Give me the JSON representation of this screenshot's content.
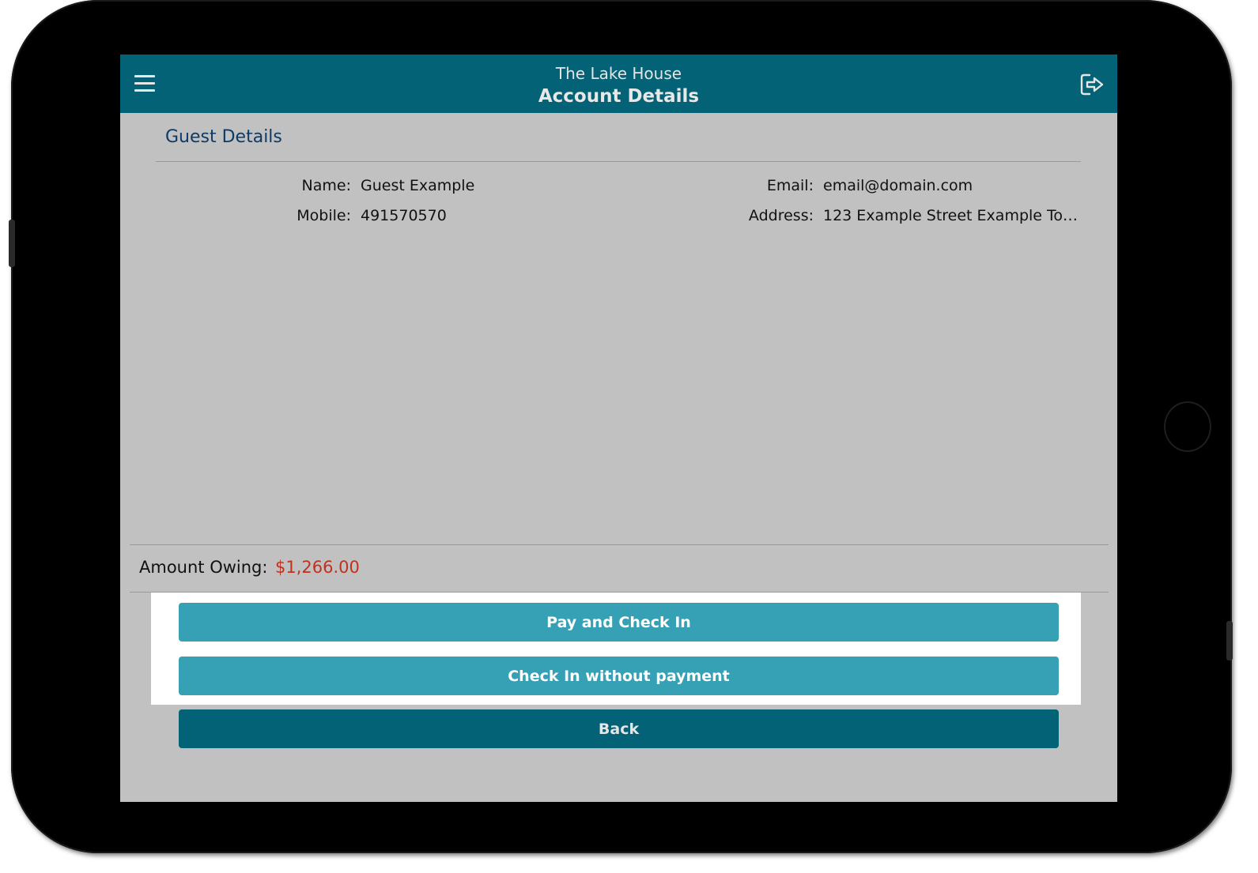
{
  "header": {
    "subtitle": "The Lake House",
    "title": "Account Details"
  },
  "section": {
    "title": "Guest Details"
  },
  "guest": {
    "name_label": "Name:",
    "name_value": "Guest Example",
    "mobile_label": "Mobile:",
    "mobile_value": "491570570",
    "email_label": "Email:",
    "email_value": "email@domain.com",
    "address_label": "Address:",
    "address_value": "123 Example Street Example Tow..."
  },
  "owing": {
    "label": "Amount Owing:",
    "value": "$1,266.00"
  },
  "actions": {
    "pay_checkin_label": "Pay and Check In",
    "checkin_no_payment_label": "Check In without payment",
    "back_label": "Back"
  },
  "icons": {
    "menu": "menu-icon",
    "logout": "logout-icon"
  },
  "colors": {
    "header": "#036275",
    "accent_button": "#36a1b5",
    "back_button": "#036275",
    "amount_owing": "#c0321e",
    "section_title": "#0d3b66",
    "screen_background": "#c1c1c1"
  }
}
